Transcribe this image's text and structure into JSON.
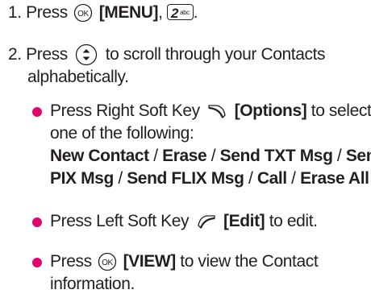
{
  "step1": {
    "number": "1.",
    "text": "Press",
    "ok_icon": "OK",
    "menu_label": "[MENU]",
    "comma": ",",
    "key_digit": "2",
    "key_letters": "abc",
    "period": "."
  },
  "step2": {
    "number": "2.",
    "text_before": "Press",
    "text_after": "to scroll through your Contacts",
    "text_line2": "alphabetically."
  },
  "bullets": {
    "b1_before": "Press Right Soft Key",
    "b1_label": "[Options]",
    "b1_after": "to select",
    "b1_line2": "one of the following:",
    "options": [
      {
        "label": "New Contact",
        "sep": " / "
      },
      {
        "label": "Erase",
        "sep": " / "
      },
      {
        "label": "Send TXT Msg",
        "sep": " / "
      },
      {
        "label": "Send",
        "sep": ""
      },
      {
        "label": "PIX Msg",
        "sep": " / "
      },
      {
        "label": "Send FLIX Msg",
        "sep": " / "
      },
      {
        "label": "Call",
        "sep": " / "
      },
      {
        "label": "Erase All",
        "sep": ""
      }
    ],
    "b2_before": "Press Left Soft Key",
    "b2_label": "[Edit]",
    "b2_after": "to edit.",
    "b3_before": "Press",
    "b3_ok_icon": "OK",
    "b3_label": "[VIEW]",
    "b3_after": "to view the Contact",
    "b3_line2": "information."
  },
  "colors": {
    "text": "#231f20",
    "bullet": "#e1066e"
  },
  "icons": [
    "ok-key-icon",
    "two-abc-key-icon",
    "nav-up-down-icon",
    "right-soft-key-icon",
    "left-soft-key-icon"
  ]
}
